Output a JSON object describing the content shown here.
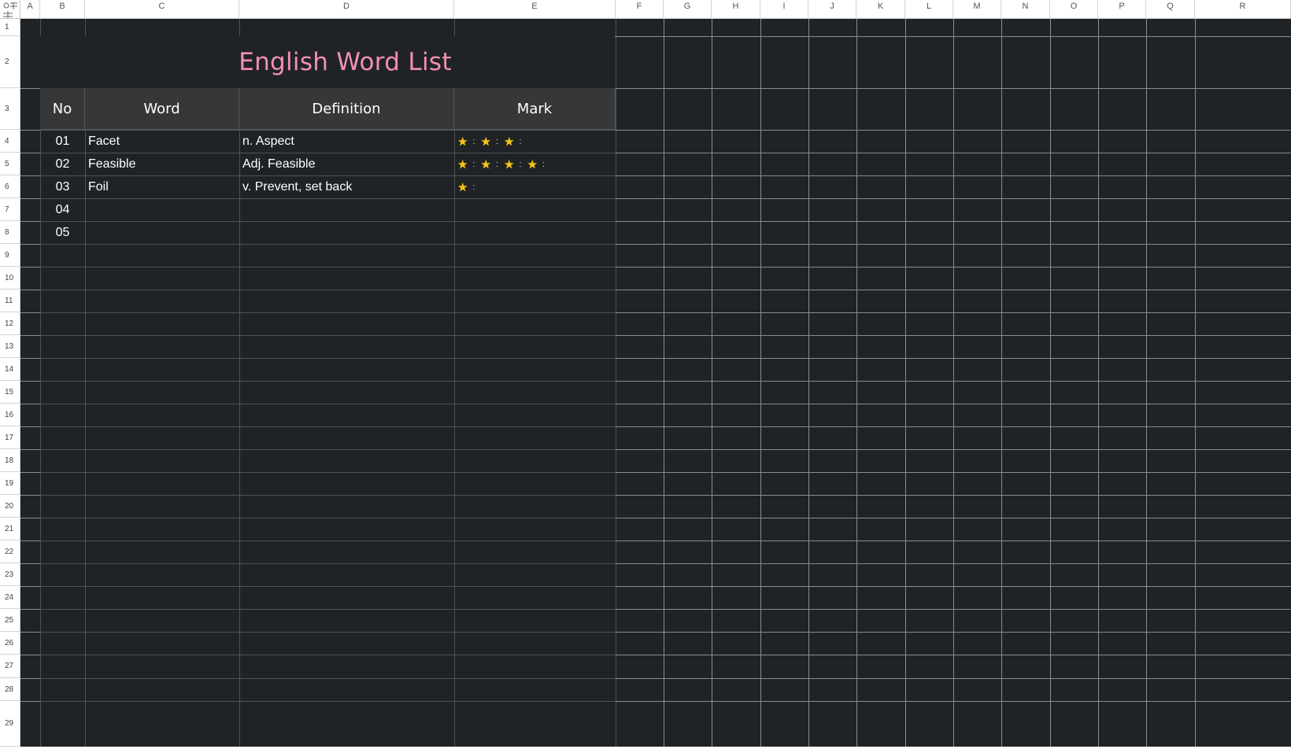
{
  "columns": [
    "A",
    "B",
    "C",
    "D",
    "E",
    "F",
    "G",
    "H",
    "I",
    "J",
    "K",
    "L",
    "M",
    "N",
    "O",
    "P",
    "Q",
    "R"
  ],
  "rows": [
    "1",
    "2",
    "3",
    "4",
    "5",
    "6",
    "7",
    "8",
    "9",
    "10",
    "11",
    "12",
    "13",
    "14",
    "15",
    "16",
    "17",
    "18",
    "19",
    "20",
    "21",
    "22",
    "23",
    "24",
    "25",
    "26",
    "27",
    "28",
    "29"
  ],
  "sheet": {
    "title": "English Word List",
    "headers": {
      "no": "No",
      "word": "Word",
      "definition": "Definition",
      "mark": "Mark"
    },
    "entries": [
      {
        "no": "01",
        "word": "Facet",
        "definition": "n. Aspect",
        "stars": 3
      },
      {
        "no": "02",
        "word": "Feasible",
        "definition": "Adj. Feasible",
        "stars": 4
      },
      {
        "no": "03",
        "word": "Foil",
        "definition": "v. Prevent, set back",
        "stars": 1
      },
      {
        "no": "04",
        "word": "",
        "definition": "",
        "stars": 0
      },
      {
        "no": "05",
        "word": "",
        "definition": "",
        "stars": 0
      }
    ]
  },
  "colors": {
    "background": "#202326",
    "header_fill": "#363738",
    "title_color": "#f48fb1",
    "star_color": "#f5c518",
    "grid_light": "#8a8d90",
    "grid_dark": "#505355"
  },
  "icons": {
    "star": "★",
    "corner": "freeze-panes-icon"
  }
}
